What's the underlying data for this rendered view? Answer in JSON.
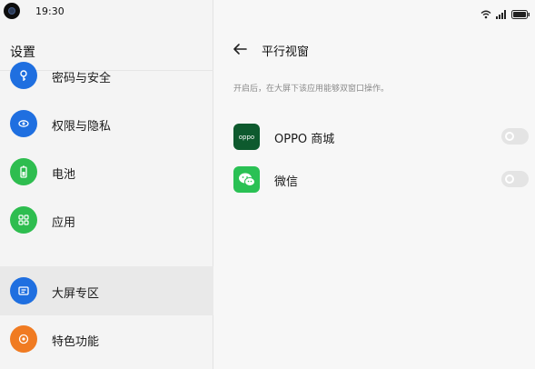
{
  "status_bar": {
    "time": "19:30",
    "icons": [
      "wifi-icon",
      "signal-icon",
      "battery-icon"
    ]
  },
  "left_panel": {
    "title": "设置",
    "items": [
      {
        "label": "密码与安全",
        "icon": "key-shield-icon",
        "color": "#1f6fe0"
      },
      {
        "label": "权限与隐私",
        "icon": "privacy-icon",
        "color": "#1f6fe0"
      },
      {
        "label": "电池",
        "icon": "battery-icon",
        "color": "#2ebd4f"
      },
      {
        "label": "应用",
        "icon": "apps-grid-icon",
        "color": "#2ebd4f"
      },
      {
        "label": "大屏专区",
        "icon": "large-screen-icon",
        "color": "#1f6fe0",
        "selected": true
      },
      {
        "label": "特色功能",
        "icon": "features-icon",
        "color": "#f07b22"
      }
    ]
  },
  "right_panel": {
    "title": "平行视窗",
    "description": "开启后，在大屏下该应用能够双窗口操作。",
    "apps": [
      {
        "name": "OPPO 商城",
        "icon": "oppo-store-icon",
        "icon_text": "oppo",
        "color": "#0e5a2e",
        "enabled": false
      },
      {
        "name": "微信",
        "icon": "wechat-icon",
        "color": "#2ac154",
        "enabled": false
      }
    ]
  }
}
